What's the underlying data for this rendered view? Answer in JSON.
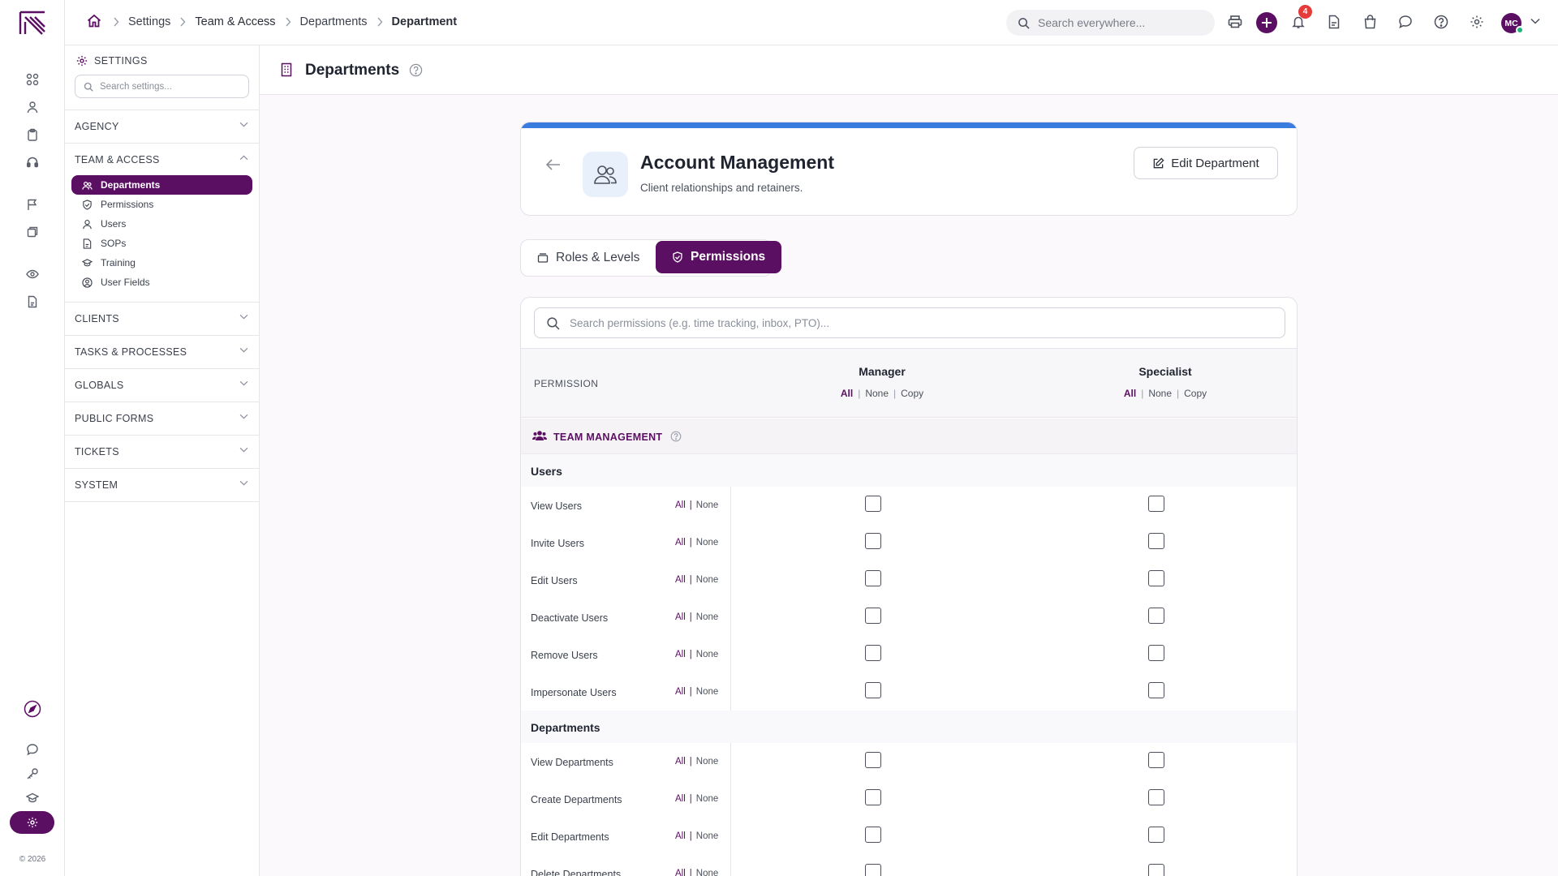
{
  "rail": {
    "copyright": "© 2026",
    "icons": [
      "apps-icon",
      "user-icon",
      "clipboard-icon",
      "headset-icon",
      "flag-icon",
      "box-icon",
      "eye-icon",
      "document-icon",
      "rocket-icon",
      "chat-icon",
      "key-icon",
      "graduation-icon",
      "gear-icon"
    ]
  },
  "topbar": {
    "breadcrumbs": [
      "Settings",
      "Team & Access",
      "Departments",
      "Department"
    ],
    "search_placeholder": "Search everywhere...",
    "notification_count": "4",
    "avatar_initials": "MC"
  },
  "settings": {
    "header": "SETTINGS",
    "search_placeholder": "Search settings...",
    "sections": [
      {
        "label": "AGENCY",
        "expanded": false
      },
      {
        "label": "TEAM & ACCESS",
        "expanded": true
      },
      {
        "label": "CLIENTS",
        "expanded": false
      },
      {
        "label": "TASKS & PROCESSES",
        "expanded": false
      },
      {
        "label": "GLOBALS",
        "expanded": false
      },
      {
        "label": "PUBLIC FORMS",
        "expanded": false
      },
      {
        "label": "TICKETS",
        "expanded": false
      },
      {
        "label": "SYSTEM",
        "expanded": false
      }
    ],
    "team_items": [
      {
        "label": "Departments",
        "icon": "departments-icon",
        "active": true
      },
      {
        "label": "Permissions",
        "icon": "shield-icon",
        "active": false
      },
      {
        "label": "Users",
        "icon": "user-icon",
        "active": false
      },
      {
        "label": "SOPs",
        "icon": "document-icon",
        "active": false
      },
      {
        "label": "Training",
        "icon": "graduation-icon",
        "active": false
      },
      {
        "label": "User Fields",
        "icon": "user-circle-icon",
        "active": false
      }
    ]
  },
  "page": {
    "title": "Departments"
  },
  "department": {
    "name": "Account Management",
    "description": "Client relationships and retainers.",
    "edit_label": "Edit Department",
    "accent_color": "#3a7be0"
  },
  "tabs": [
    {
      "label": "Roles & Levels",
      "active": false
    },
    {
      "label": "Permissions",
      "active": true
    }
  ],
  "permissions": {
    "search_placeholder": "Search permissions (e.g. time tracking, inbox, PTO)...",
    "column_label": "PERMISSION",
    "roles": [
      "Manager",
      "Specialist"
    ],
    "bulk": {
      "all": "All",
      "none": "None",
      "copy": "Copy"
    },
    "row_all": "All",
    "row_none": "None",
    "group": "TEAM MANAGEMENT",
    "subgroups": [
      {
        "label": "Users",
        "rows": [
          "View Users",
          "Invite Users",
          "Edit Users",
          "Deactivate Users",
          "Remove Users",
          "Impersonate Users"
        ]
      },
      {
        "label": "Departments",
        "rows": [
          "View Departments",
          "Create Departments",
          "Edit Departments",
          "Delete Departments"
        ]
      }
    ]
  },
  "colors": {
    "brand": "#5b0f63",
    "badge": "#e53b3b",
    "online": "#1fb47a"
  }
}
